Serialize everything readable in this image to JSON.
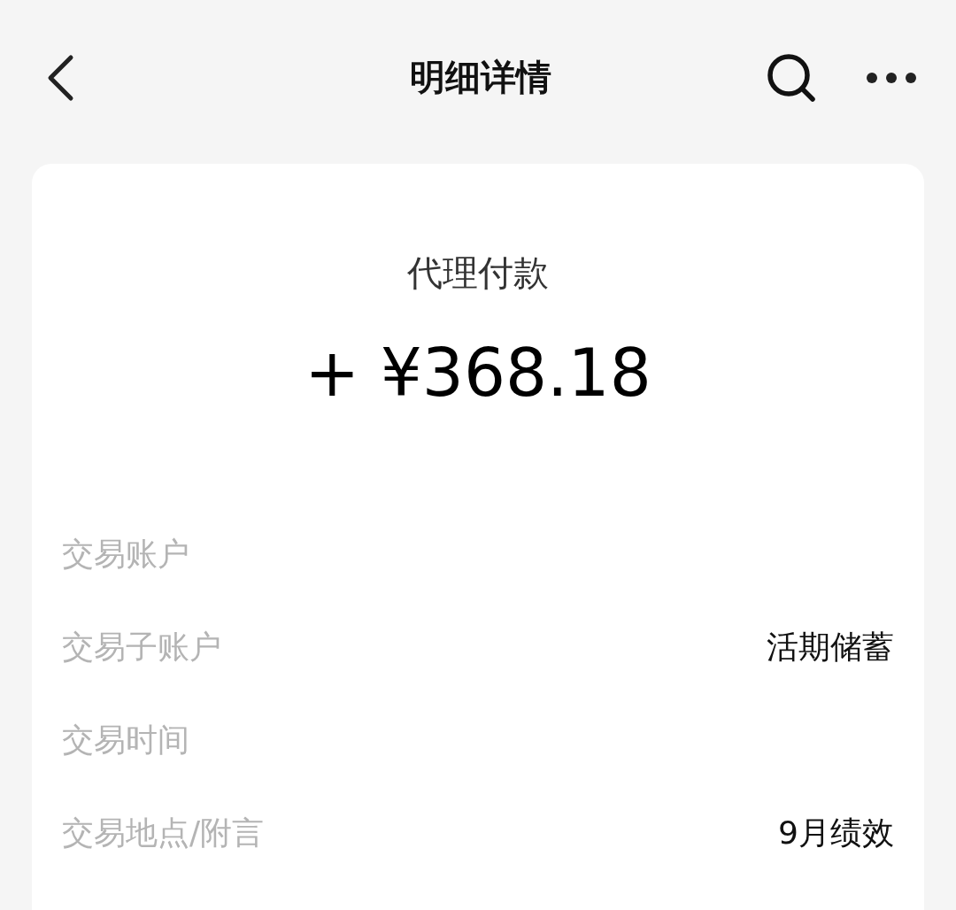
{
  "header": {
    "title": "明细详情"
  },
  "summary": {
    "type": "代理付款",
    "amount": "+ ¥368.18"
  },
  "details": [
    {
      "label": "交易账户"
    },
    {
      "label": "交易子账户",
      "value": "活期储蓄"
    },
    {
      "label": "交易时间"
    },
    {
      "label": "交易地点/附言",
      "value": "9月绩效"
    }
  ]
}
